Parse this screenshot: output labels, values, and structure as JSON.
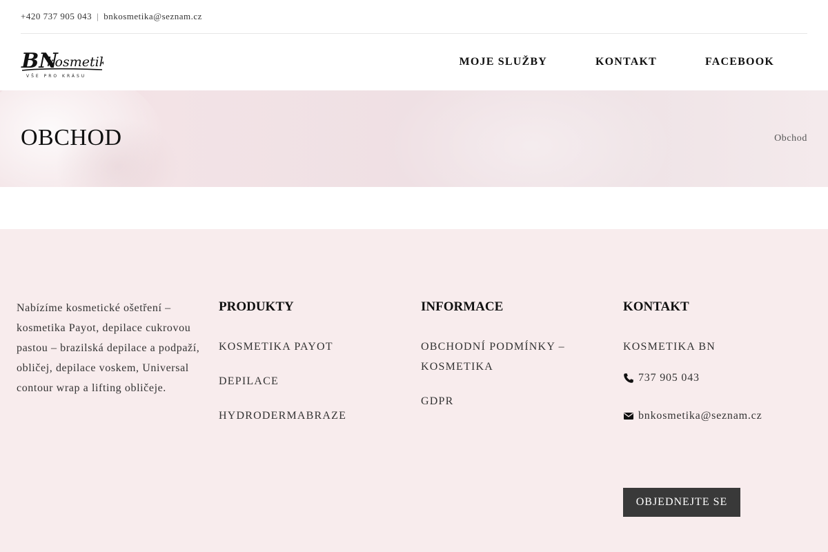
{
  "topbar": {
    "phone": "+420 737 905 043",
    "separator": "|",
    "email": "bnkosmetika@seznam.cz"
  },
  "header": {
    "logo_text": "BN kosmetika",
    "logo_tagline": "VŠE PRO KRÁSU",
    "nav": [
      {
        "label": "MOJE SLUŽBY"
      },
      {
        "label": "KONTAKT"
      },
      {
        "label": "FACEBOOK"
      }
    ]
  },
  "hero": {
    "title": "OBCHOD",
    "breadcrumb": "Obchod"
  },
  "footer": {
    "about": "Nabízíme kosmetické ošetření – kosmetika Payot, depilace cukrovou pastou – brazilská depilace a podpaží, obličej, depilace voskem, Universal contour wrap a lifting obličeje.",
    "products": {
      "title": "PRODUKTY",
      "items": [
        {
          "label": "KOSMETIKA PAYOT"
        },
        {
          "label": "DEPILACE"
        },
        {
          "label": "HYDRODERMABRAZE"
        }
      ]
    },
    "info": {
      "title": "INFORMACE",
      "items": [
        {
          "label": "OBCHODNÍ PODMÍNKY – KOSMETIKA"
        },
        {
          "label": "GDPR"
        }
      ]
    },
    "contact": {
      "title": "KONTAKT",
      "name": "KOSMETIKA BN",
      "phone": "737 905 043",
      "email": "bnkosmetika@seznam.cz",
      "phone_icon": "phone-icon",
      "email_icon": "envelope-icon",
      "order_button": "OBJEDNEJTE SE"
    }
  },
  "colors": {
    "footer_bg": "#f8eced",
    "button_bg": "#393939",
    "hero_tint": "#f1dfe2"
  }
}
